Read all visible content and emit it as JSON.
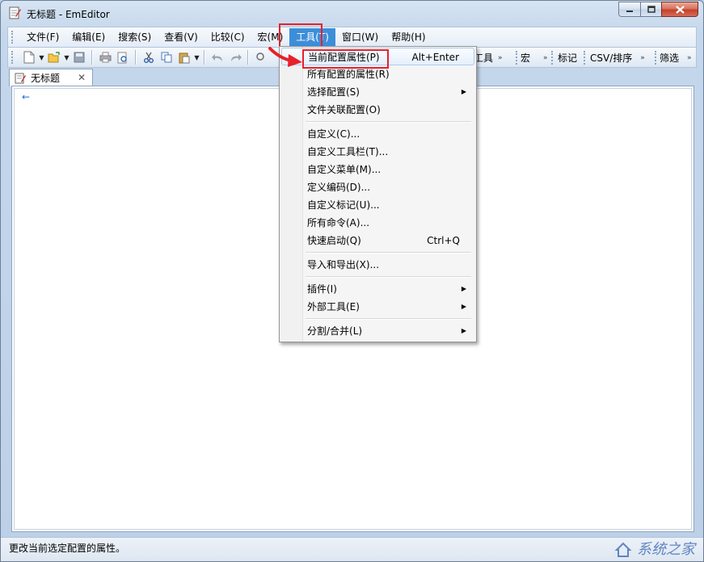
{
  "window": {
    "title": "无标题 - EmEditor"
  },
  "menubar": {
    "items": [
      "文件(F)",
      "编辑(E)",
      "搜索(S)",
      "查看(V)",
      "比较(C)",
      "宏(M)",
      "工具(T)",
      "窗口(W)",
      "帮助(H)"
    ],
    "active_index": 6
  },
  "toolbar": {
    "sections": [
      "工具",
      "宏",
      "标记",
      "CSV/排序",
      "筛选"
    ]
  },
  "tab": {
    "label": "无标题"
  },
  "editor": {
    "eol_mark": "←"
  },
  "dropdown": {
    "groups": [
      [
        {
          "label": "当前配置属性(P)",
          "shortcut": "Alt+Enter",
          "submenu": false
        },
        {
          "label": "所有配置的属性(R)",
          "shortcut": "",
          "submenu": false
        },
        {
          "label": "选择配置(S)",
          "shortcut": "",
          "submenu": true
        },
        {
          "label": "文件关联配置(O)",
          "shortcut": "",
          "submenu": false
        }
      ],
      [
        {
          "label": "自定义(C)...",
          "shortcut": "",
          "submenu": false
        },
        {
          "label": "自定义工具栏(T)...",
          "shortcut": "",
          "submenu": false
        },
        {
          "label": "自定义菜单(M)...",
          "shortcut": "",
          "submenu": false
        },
        {
          "label": "定义编码(D)...",
          "shortcut": "",
          "submenu": false
        },
        {
          "label": "自定义标记(U)...",
          "shortcut": "",
          "submenu": false
        },
        {
          "label": "所有命令(A)...",
          "shortcut": "",
          "submenu": false
        },
        {
          "label": "快速启动(Q)",
          "shortcut": "Ctrl+Q",
          "submenu": false
        }
      ],
      [
        {
          "label": "导入和导出(X)...",
          "shortcut": "",
          "submenu": false
        }
      ],
      [
        {
          "label": "插件(I)",
          "shortcut": "",
          "submenu": true
        },
        {
          "label": "外部工具(E)",
          "shortcut": "",
          "submenu": true
        }
      ],
      [
        {
          "label": "分割/合并(L)",
          "shortcut": "",
          "submenu": true
        }
      ]
    ]
  },
  "statusbar": {
    "text": "更改当前选定配置的属性。"
  },
  "watermark": {
    "text": "系统之家"
  },
  "colors": {
    "menu_active": "#3d8ed9",
    "annotation_red": "#e8202a"
  }
}
